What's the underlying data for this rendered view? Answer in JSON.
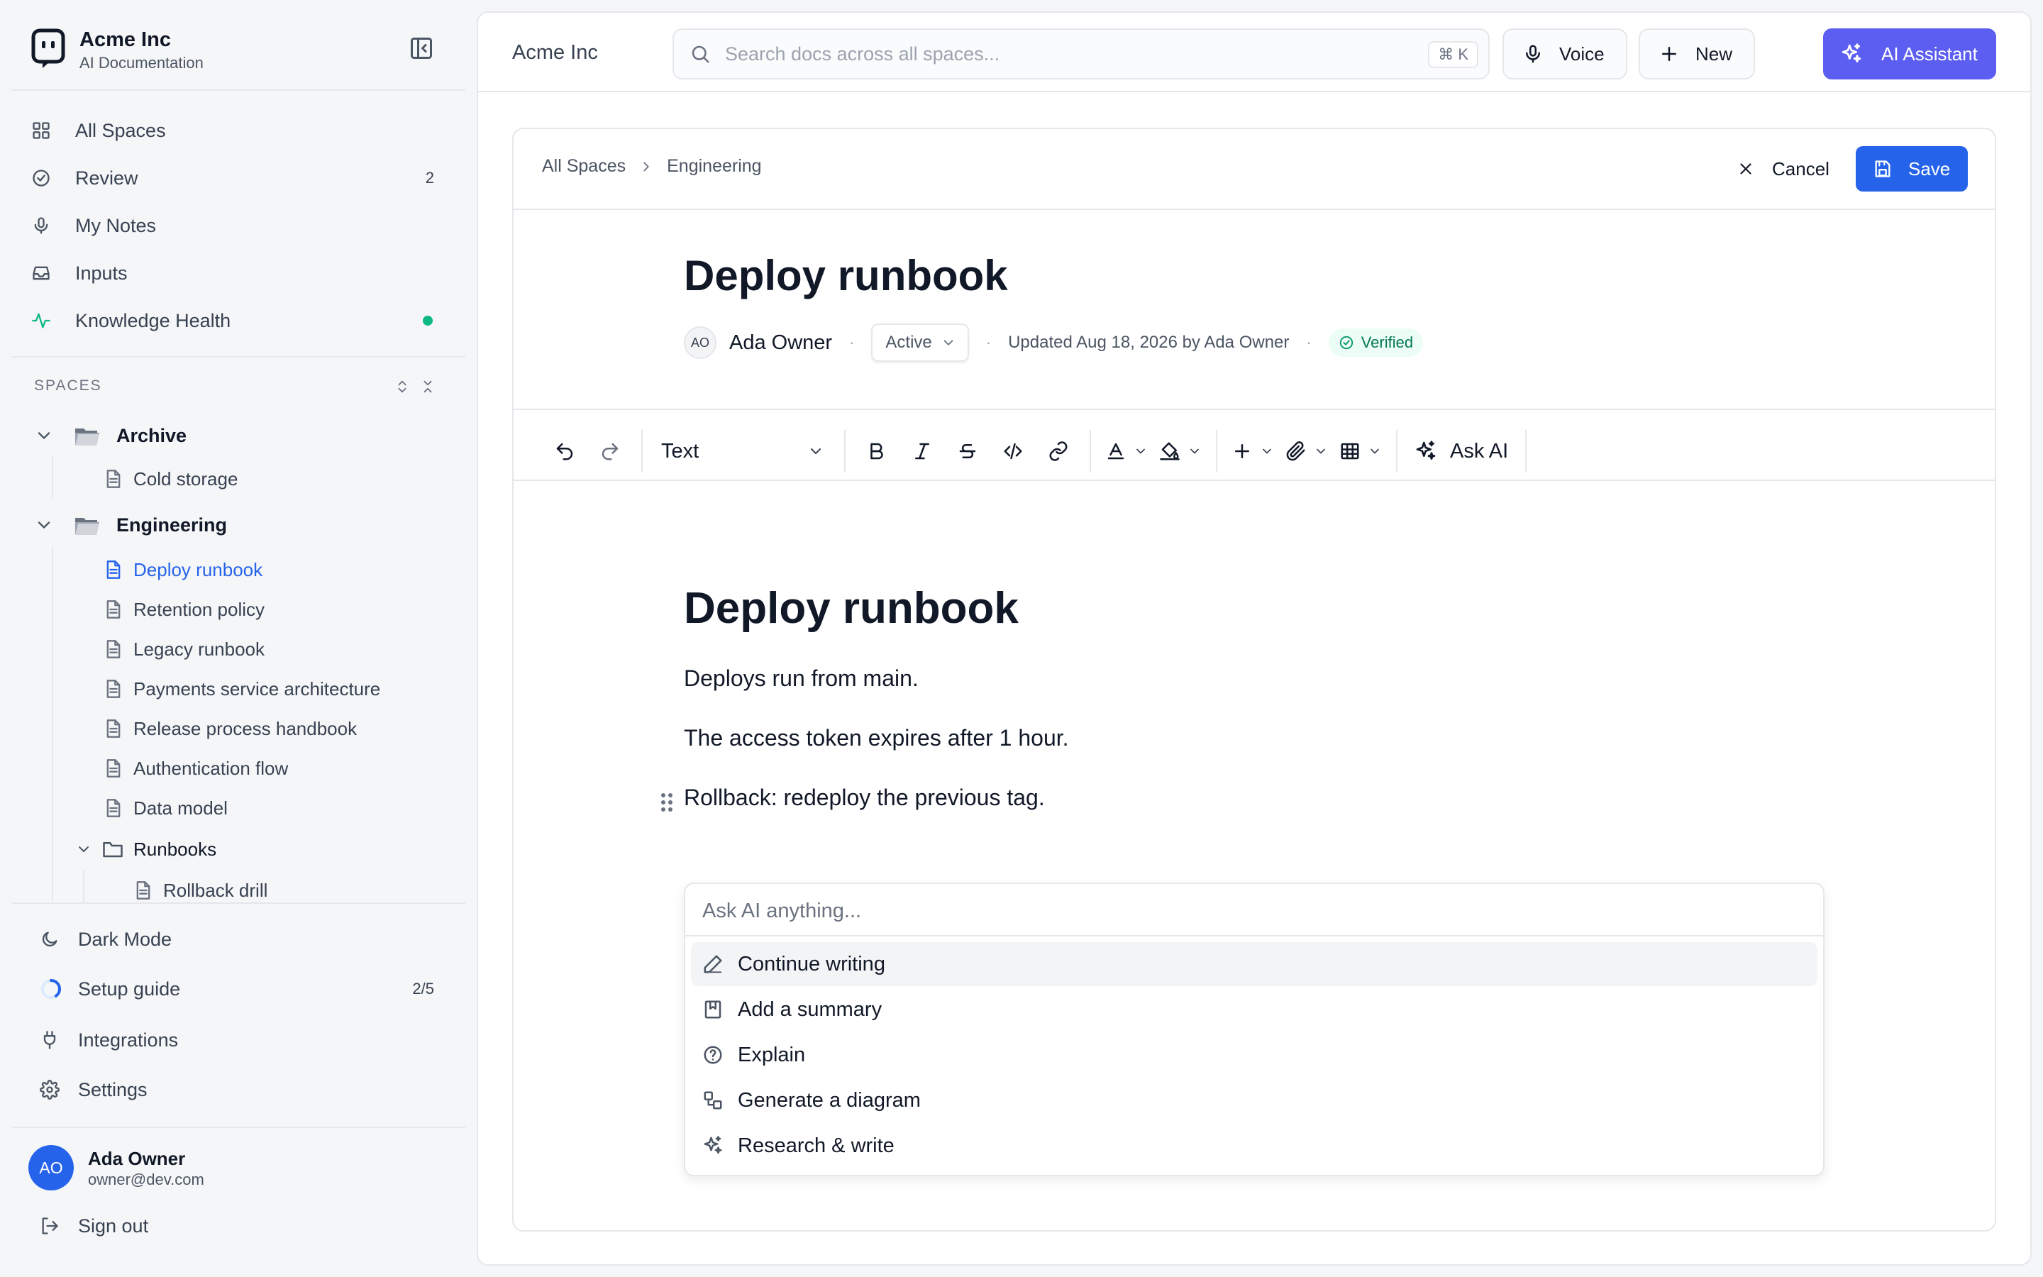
{
  "brand": {
    "name": "Acme Inc",
    "subtitle": "AI Documentation"
  },
  "nav": [
    {
      "label": "All Spaces",
      "icon": "grid-icon"
    },
    {
      "label": "Review",
      "icon": "check-circle-icon",
      "count": "2"
    },
    {
      "label": "My Notes",
      "icon": "microphone-icon"
    },
    {
      "label": "Inputs",
      "icon": "inbox-icon"
    },
    {
      "label": "Knowledge Health",
      "icon": "activity-icon",
      "status_color": "#10b981"
    }
  ],
  "spaces": {
    "heading": "SPACES",
    "archive": {
      "label": "Archive",
      "docs": [
        "Cold storage"
      ]
    },
    "engineering": {
      "label": "Engineering",
      "docs": [
        "Deploy runbook",
        "Retention policy",
        "Legacy runbook",
        "Payments service architecture",
        "Release process handbook",
        "Authentication flow",
        "Data model"
      ],
      "subfolder": {
        "label": "Runbooks",
        "docs": [
          "Rollback drill"
        ]
      }
    }
  },
  "bottom_nav": [
    {
      "label": "Dark Mode",
      "icon": "moon-icon"
    },
    {
      "label": "Setup guide",
      "icon": "progress-ring-icon",
      "count": "2/5",
      "progress": 0.4
    },
    {
      "label": "Integrations",
      "icon": "plug-icon"
    },
    {
      "label": "Settings",
      "icon": "gear-icon"
    }
  ],
  "user": {
    "initials": "AO",
    "name": "Ada Owner",
    "email": "owner@dev.com",
    "sign_out": "Sign out"
  },
  "topbar": {
    "title": "Acme Inc",
    "search_placeholder": "Search docs across all spaces...",
    "shortcut": "⌘ K",
    "voice_label": "Voice",
    "new_label": "New",
    "ai_label": "AI Assistant",
    "ai_color": "#5b5ef0"
  },
  "doc": {
    "breadcrumb": [
      "All Spaces",
      "Engineering"
    ],
    "cancel_label": "Cancel",
    "save_label": "Save",
    "accent_color": "#2563eb",
    "title": "Deploy runbook",
    "author_initials": "AO",
    "author": "Ada Owner",
    "status": "Active",
    "updated": "Updated Aug 18, 2026 by Ada Owner",
    "verified": "Verified",
    "meta_sep": "·"
  },
  "toolbar": {
    "block_type": "Text",
    "ask_ai": "Ask AI"
  },
  "editor": {
    "heading": "Deploy runbook",
    "paragraphs": [
      "Deploys run from main.",
      "The access token expires after 1 hour.",
      "Rollback: redeploy the previous tag."
    ]
  },
  "ai_menu": {
    "placeholder": "Ask AI anything...",
    "options": [
      {
        "label": "Continue writing",
        "icon": "pencil-icon"
      },
      {
        "label": "Add a summary",
        "icon": "bookmark-icon"
      },
      {
        "label": "Explain",
        "icon": "help-circle-icon"
      },
      {
        "label": "Generate a diagram",
        "icon": "diagram-icon"
      },
      {
        "label": "Research & write",
        "icon": "sparkles-icon"
      }
    ]
  }
}
